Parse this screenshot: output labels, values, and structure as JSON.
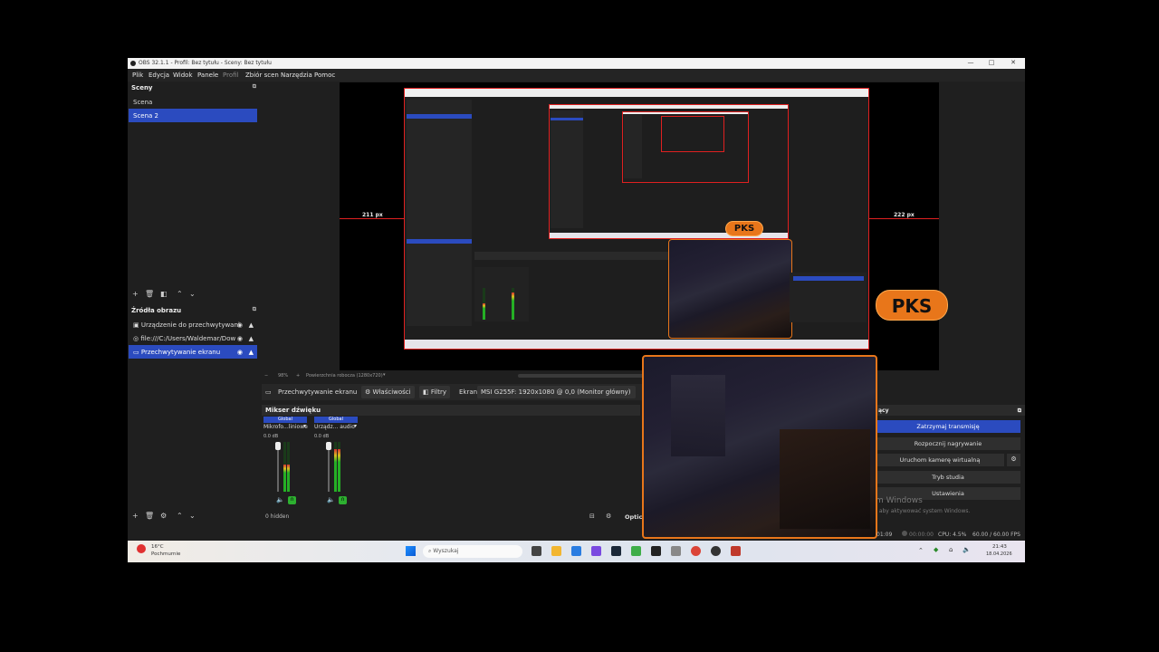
{
  "window": {
    "title": "OBS 32.1.1 - Profil: Bez tytułu - Sceny: Bez tytułu",
    "controls": [
      "—",
      "□",
      "✕"
    ]
  },
  "menu": [
    "Plik",
    "Edycja",
    "Widok",
    "Panele",
    "Profil",
    "Zbiór scen",
    "Narzędzia",
    "Pomoc"
  ],
  "scenes": {
    "title": "Sceny",
    "items": [
      "Scena",
      "Scena 2"
    ],
    "selected_index": 1
  },
  "sources": {
    "title": "Źródła obrazu",
    "items": [
      "Urządzenie do przechwytywani",
      "file:///C:/Users/Waldemar/Dow",
      "Przechwytywanie ekranu"
    ],
    "selected_index": 2
  },
  "preview": {
    "left_distance": "211 px",
    "right_distance": "222 px",
    "zoom": "98%",
    "scale_mode": "Powierzchnia robocza (1280x720)"
  },
  "overlay": {
    "badge_text": "PKS"
  },
  "source_toolbar": {
    "source_name": "Przechwytywanie ekranu",
    "properties_label": "Właściwości",
    "filters_label": "Filtry",
    "screen_label": "Ekran",
    "screen_value": "MSI G255F: 1920x1080 @ 0,0 (Monitor główny)"
  },
  "mixer": {
    "title": "Mikser dźwięku",
    "channels": [
      {
        "header": "Global",
        "name": "Mikrofo...liniowe",
        "db": "0.0 dB",
        "level": 0.55
      },
      {
        "header": "Global",
        "name": "Urządz... audio",
        "db": "0.0 dB",
        "level": 0.85
      }
    ],
    "hidden_label": "0 hidden",
    "options_label": "Optic"
  },
  "controls": {
    "title": "ący",
    "buttons": [
      "Zatrzymaj transmisję",
      "Rozpocznij nagrywanie",
      "Uruchom kamerę wirtualną",
      "Tryb studia",
      "Ustawienia"
    ],
    "active_index": 0
  },
  "activation": {
    "line1": "m Windows",
    "line2": ", aby aktywować system Windows."
  },
  "status": {
    "stream_time": "01:09",
    "rec_time": "00:00:00",
    "cpu": "CPU: 4.5%",
    "fps": "60.00 / 60.00 FPS"
  },
  "taskbar": {
    "weather_temp": "16°C",
    "weather_desc": "Pochmurnie",
    "search_placeholder": "Wyszukaj",
    "time": "21:43",
    "date": "18.04.2026",
    "colors": {
      "accent": "#2b4bbf",
      "orange": "#e8761a",
      "red": "#e02020"
    }
  }
}
